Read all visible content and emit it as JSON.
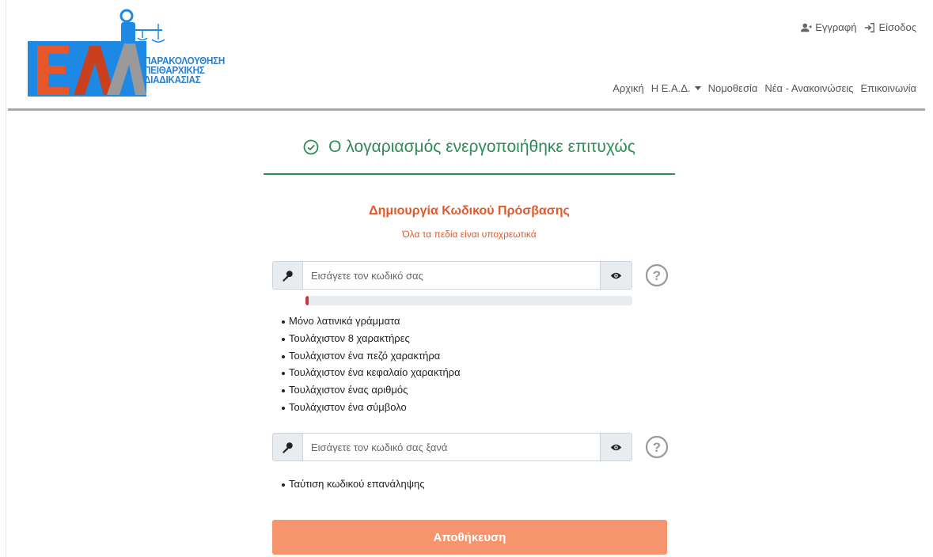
{
  "header": {
    "logo_text": [
      "ΠΑΡΑΚΟΛΟΥΘΗΣΗ",
      "ΠΕΙΘΑΡΧΙΚΗΣ",
      "ΔΙΑΔΙΚΑΣΙΑΣ"
    ],
    "auth": {
      "register_label": "Εγγραφή",
      "login_label": "Είσοδος"
    },
    "nav": {
      "home": "Αρχική",
      "about": "Η Ε.Α.Δ.",
      "legislation": "Νομοθεσία",
      "news": "Νέα - Ανακοινώσεις",
      "contact": "Επικοινωνία"
    }
  },
  "success_message": "Ο λογαριασμός ενεργοποιήθηκε επιτυχώς",
  "form": {
    "title": "Δημιουργία Κωδικού Πρόσβασης",
    "subtitle": "Όλα τα πεδία είναι υποχρεωτικά",
    "password": {
      "value": "",
      "placeholder": "Εισάγετε τον κωδικό σας",
      "strength_fraction": 0.01
    },
    "password_rules": [
      "Μόνο λατινικά γράμματα",
      "Τουλάχιστον 8 χαρακτήρες",
      "Τουλάχιστον ένα πεζό χαρακτήρα",
      "Τουλάχιστον ένα κεφαλαίο χαρακτήρα",
      "Τουλάχιστον ένας αριθμός",
      "Τουλάχιστον ένα σύμβολο"
    ],
    "confirm": {
      "value": "",
      "placeholder": "Εισάγετε τον κωδικό σας ξανά"
    },
    "confirm_rules": [
      "Ταύτιση κωδικού επανάληψης"
    ],
    "save_label": "Αποθήκευση"
  },
  "icons": {
    "key": "key-icon",
    "eye": "eye-icon",
    "help": "question-circle-icon",
    "success": "check-circle-icon",
    "register": "user-plus-icon",
    "login": "sign-in-icon"
  },
  "colors": {
    "brand_blue": "#2a7fd0",
    "brand_orange": "#e8572a",
    "brand_gray": "#9a9a9a",
    "success_green": "#2e8b57",
    "accent_orange": "#e05a2b",
    "button_orange": "#f4956d",
    "strength_red": "#d0343a"
  }
}
